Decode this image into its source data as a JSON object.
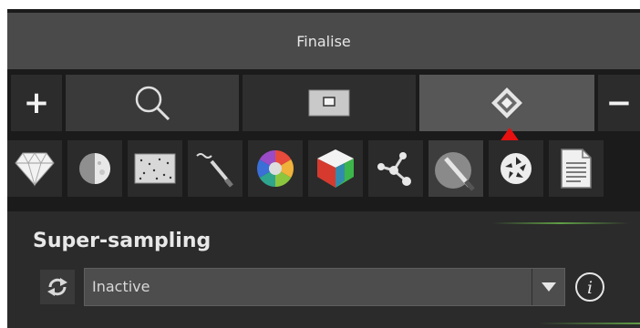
{
  "title_bar": {
    "title": "Finalise"
  },
  "tabs": [
    {
      "name": "add",
      "label": "+",
      "icon": "plus-icon"
    },
    {
      "name": "search",
      "icon": "search-icon"
    },
    {
      "name": "image",
      "icon": "image-frame-icon"
    },
    {
      "name": "finalise",
      "icon": "finalise-diamond-icon",
      "selected": true
    },
    {
      "name": "remove",
      "label": "−",
      "icon": "minus-icon"
    }
  ],
  "tools": [
    {
      "icon": "diamond-icon"
    },
    {
      "icon": "moon-phase-icon"
    },
    {
      "icon": "noise-icon"
    },
    {
      "icon": "brush-icon"
    },
    {
      "icon": "color-wheel-icon"
    },
    {
      "icon": "color-cube-icon"
    },
    {
      "icon": "molecule-icon"
    },
    {
      "icon": "pipette-icon",
      "active": true
    },
    {
      "icon": "aperture-icon"
    },
    {
      "icon": "document-icon"
    }
  ],
  "panel": {
    "section_title": "Super-sampling",
    "mode_icon": "cycle-icon",
    "dropdown": {
      "value": "Inactive",
      "icon": "chevron-down-icon"
    },
    "info_icon": "info-icon"
  },
  "colors": {
    "background": "#1b1b1b",
    "title_bar": "#4a4a4a",
    "active_tab": "#575757",
    "accent_marker": "#e81010",
    "accent_line": "#5f9e45"
  }
}
